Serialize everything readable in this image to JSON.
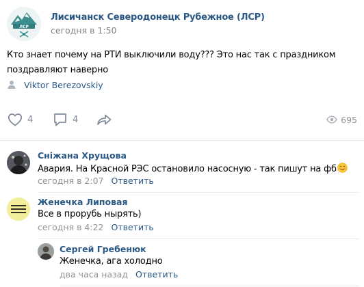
{
  "post": {
    "group_name": "Лисичанск Северодонецк Рубежное (ЛСР)",
    "time": "сегодня в 1:50",
    "text_line1": "Кто знает почему на РТИ выключили воду??? Это нас так с праздником",
    "text_line2": "поздравляют наверно",
    "author": "Viktor Berezovskiy",
    "likes": "4",
    "comments_count": "4",
    "views": "695",
    "avatar_text": "ЛСР"
  },
  "comments": [
    {
      "author": "Сніжана Хрущова",
      "text": "Авария. На Красной РЭС остановило насосную - так пишут на фб",
      "time": "сегодня в 2:07",
      "reply": "Ответить"
    },
    {
      "author": "Женечка Липовая",
      "text": "Все в прорубь нырять)",
      "time": "сегодня в 4:22",
      "reply": "Ответить",
      "avatar_text": "Это было\nЭто есть\nЭто будет"
    },
    {
      "author": "Сергей Гребенюк",
      "text": "Женечка, ага холодно",
      "time": "два часа назад",
      "reply": "Ответить"
    }
  ],
  "colors": {
    "link": "#2a5885",
    "secondary": "#828282",
    "icon": "#828a99",
    "divider": "#e7e8ec"
  },
  "icons": [
    "person-icon",
    "heart-icon",
    "comment-icon",
    "share-icon",
    "eye-icon",
    "smile-emoji-icon"
  ]
}
